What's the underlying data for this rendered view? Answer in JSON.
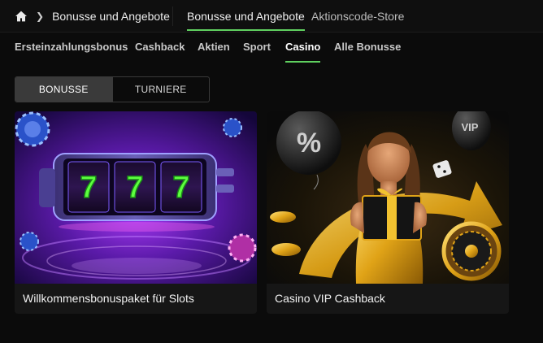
{
  "breadcrumb": {
    "home_icon": "home-icon",
    "separator_icon": "chevron-right-icon",
    "label": "Bonusse und Angebote"
  },
  "top_tabs": [
    {
      "label": "Bonusse und Angebote",
      "active": true
    },
    {
      "label": "Aktionscode-Store",
      "active": false
    }
  ],
  "sub_tabs": [
    {
      "label": "Ersteinzahlungsbonus",
      "active": false
    },
    {
      "label": "Cashback",
      "active": false
    },
    {
      "label": "Aktien",
      "active": false
    },
    {
      "label": "Sport",
      "active": false
    },
    {
      "label": "Casino",
      "active": true
    },
    {
      "label": "Alle Bonusse",
      "active": false
    }
  ],
  "segment": [
    {
      "label": "BONUSSE",
      "active": true
    },
    {
      "label": "TURNIERE",
      "active": false
    }
  ],
  "cards": [
    {
      "title": "Willkommensbonuspaket für Slots",
      "reel_symbol": "7"
    },
    {
      "title": "Casino VIP Cashback",
      "balloon_symbol": "%",
      "balloon_text": "VIP"
    }
  ],
  "colors": {
    "accent": "#5fd05f",
    "background": "#0b0b0b",
    "card": "#161616"
  }
}
